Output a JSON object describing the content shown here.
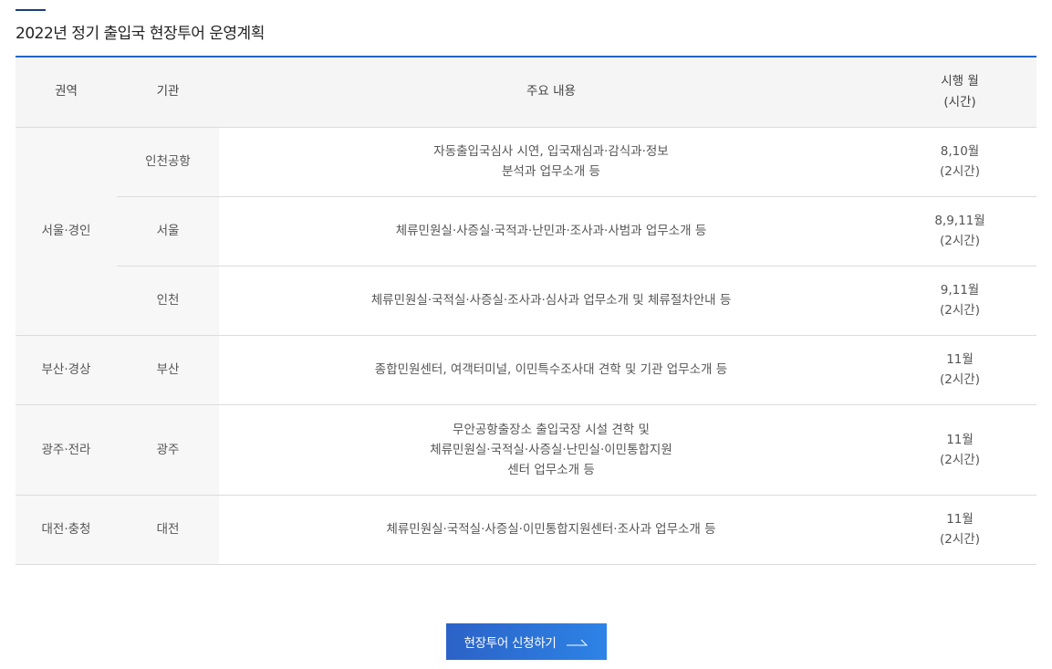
{
  "page_title": "2022년 정기 출입국 현장투어 운영계획",
  "table": {
    "headers": {
      "region": "권역",
      "agency": "기관",
      "content": "주요 내용",
      "month_line1": "시행 월",
      "month_line2": "(시간)"
    },
    "rows": [
      {
        "region": "서울·경인",
        "agency": "인천공항",
        "content_lines": [
          "자동출입국심사 시연, 입국재심과·감식과·정보",
          "분석과 업무소개 등"
        ],
        "month": "8,10월",
        "hours": "(2시간)"
      },
      {
        "agency": "서울",
        "content_lines": [
          "체류민원실·사증실·국적과·난민과·조사과·사범과 업무소개 등"
        ],
        "month": "8,9,11월",
        "hours": "(2시간)"
      },
      {
        "agency": "인천",
        "content_lines": [
          "체류민원실·국적실·사증실·조사과·심사과 업무소개 및 체류절차안내 등"
        ],
        "month": "9,11월",
        "hours": "(2시간)"
      },
      {
        "region": "부산·경상",
        "agency": "부산",
        "content_lines": [
          "종합민원센터, 여객터미널, 이민특수조사대 견학 및 기관 업무소개 등"
        ],
        "month": "11월",
        "hours": "(2시간)"
      },
      {
        "region": "광주·전라",
        "agency": "광주",
        "content_lines": [
          "무안공항출장소 출입국장 시설 견학 및",
          "체류민원실·국적실·사증실·난민실·이민통합지원",
          "센터 업무소개 등"
        ],
        "month": "11월",
        "hours": "(2시간)"
      },
      {
        "region": "대전·충청",
        "agency": "대전",
        "content_lines": [
          "체류민원실·국적실·사증실·이민통합지원센터·조사과 업무소개 등"
        ],
        "month": "11월",
        "hours": "(2시간)"
      }
    ]
  },
  "apply_button": {
    "label": "현장투어 신청하기",
    "icon": "arrow-right-icon"
  },
  "colors": {
    "accent": "#2166c9",
    "title_bar": "#1b3f7a",
    "button_start": "#2c62c7",
    "button_end": "#2d83e6"
  }
}
